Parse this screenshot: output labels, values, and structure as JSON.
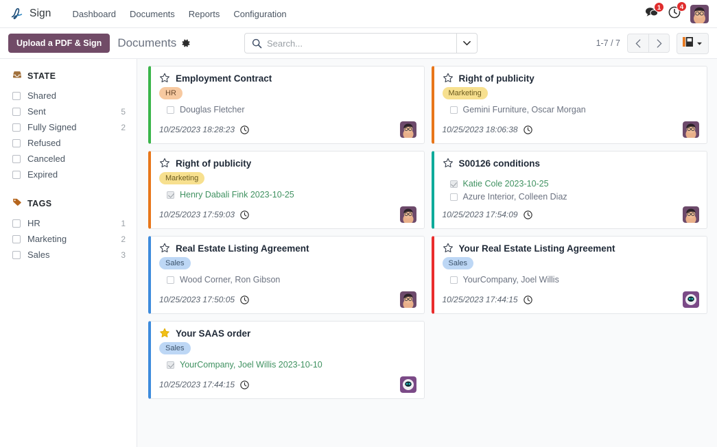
{
  "navbar": {
    "brand_name": "Sign",
    "brand_logo_icon": "sign-pen-logo-icon",
    "menu_items": [
      {
        "label": "Dashboard",
        "name": "menu-dashboard"
      },
      {
        "label": "Documents",
        "name": "menu-documents"
      },
      {
        "label": "Reports",
        "name": "menu-reports"
      },
      {
        "label": "Configuration",
        "name": "menu-configuration"
      }
    ],
    "messages": {
      "icon": "messages-icon",
      "count": "1"
    },
    "activities": {
      "icon": "activity-clock-icon",
      "count": "4"
    },
    "user_avatar_icon": "user-avatar"
  },
  "control_panel": {
    "upload_button": "Upload a PDF & Sign",
    "breadcrumb": "Documents",
    "gear_icon": "gear-icon",
    "search": {
      "placeholder": "Search...",
      "value": "",
      "icon": "search-icon",
      "toggle_icon": "chevron-down-icon"
    },
    "pager": {
      "text": "1-7 / 7",
      "prev_icon": "chevron-left-icon",
      "next_icon": "chevron-right-icon"
    },
    "view_switcher": {
      "icon": "kanban-view-icon",
      "caret_icon": "caret-down-icon"
    }
  },
  "sidebar": {
    "sections": [
      {
        "title": "STATE",
        "icon": "inbox-icon",
        "icon_color": "#a1713d",
        "items": [
          {
            "label": "Shared",
            "count": ""
          },
          {
            "label": "Sent",
            "count": "5"
          },
          {
            "label": "Fully Signed",
            "count": "2"
          },
          {
            "label": "Refused",
            "count": ""
          },
          {
            "label": "Canceled",
            "count": ""
          },
          {
            "label": "Expired",
            "count": ""
          }
        ]
      },
      {
        "title": "TAGS",
        "icon": "tag-icon",
        "icon_color": "#b5651d",
        "items": [
          {
            "label": "HR",
            "count": "1"
          },
          {
            "label": "Marketing",
            "count": "2"
          },
          {
            "label": "Sales",
            "count": "3"
          }
        ]
      }
    ]
  },
  "kanban": {
    "cards": [
      {
        "title": "Employment Contract",
        "favorite": false,
        "accent": "#3ab54a",
        "tag": "HR",
        "signers": [
          {
            "name": "Douglas Fletcher",
            "signed": false
          }
        ],
        "date": "10/25/2023 18:28:23",
        "avatar": "person-glasses-avatar"
      },
      {
        "title": "Right of publicity",
        "favorite": false,
        "accent": "#e8761a",
        "tag": "Marketing",
        "signers": [
          {
            "name": "Gemini Furniture, Oscar Morgan",
            "signed": false
          }
        ],
        "date": "10/25/2023 18:06:38",
        "avatar": "person-glasses-avatar"
      },
      {
        "title": "Right of publicity",
        "favorite": false,
        "accent": "#e8761a",
        "tag": "Marketing",
        "signers": [
          {
            "name": "Henry Dabali Fink 2023-10-25",
            "signed": true
          }
        ],
        "date": "10/25/2023 17:59:03",
        "avatar": "person-glasses-avatar"
      },
      {
        "title": "S00126 conditions",
        "favorite": false,
        "accent": "#0eab9b",
        "tag": "",
        "signers": [
          {
            "name": "Katie Cole 2023-10-25",
            "signed": true
          },
          {
            "name": "Azure Interior, Colleen Diaz",
            "signed": false
          }
        ],
        "date": "10/25/2023 17:54:09",
        "avatar": "person-glasses-avatar"
      },
      {
        "title": "Real Estate Listing Agreement",
        "favorite": false,
        "accent": "#3d8bdc",
        "tag": "Sales",
        "signers": [
          {
            "name": "Wood Corner, Ron Gibson",
            "signed": false
          }
        ],
        "date": "10/25/2023 17:50:05",
        "avatar": "person-glasses-avatar"
      },
      {
        "title": "Your Real Estate Listing Agreement",
        "favorite": false,
        "accent": "#ea2d2d",
        "tag": "Sales",
        "signers": [
          {
            "name": "YourCompany, Joel Willis",
            "signed": false
          }
        ],
        "date": "10/25/2023 17:44:15",
        "avatar": "robot-avatar"
      },
      {
        "title": "Your SAAS order",
        "favorite": true,
        "accent": "#3d8bdc",
        "tag": "Sales",
        "signers": [
          {
            "name": "YourCompany, Joel Willis 2023-10-10",
            "signed": true
          }
        ],
        "date": "10/25/2023 17:44:15",
        "avatar": "robot-avatar"
      }
    ]
  }
}
